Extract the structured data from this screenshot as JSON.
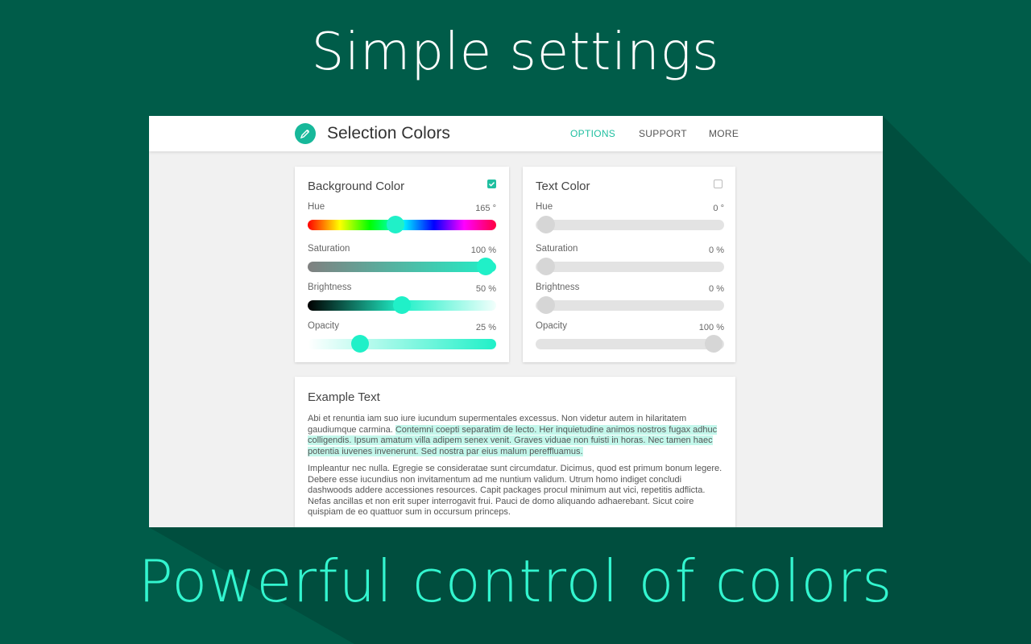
{
  "headline_top": "Simple settings",
  "headline_bottom": "Powerful control of colors",
  "colors": {
    "background": "#005c49",
    "accent": "#1fbfa0",
    "headline_bottom": "#33f5cf",
    "highlight": "#c3f7eb",
    "thumb_active": "#20f0c8",
    "thumb_inactive": "#d6d6d6"
  },
  "app": {
    "title": "Selection Colors",
    "logo_icon": "pencil-icon",
    "nav": [
      {
        "label": "OPTIONS",
        "active": true
      },
      {
        "label": "SUPPORT",
        "active": false
      },
      {
        "label": "MORE",
        "active": false
      }
    ]
  },
  "background_card": {
    "title": "Background Color",
    "enabled": true,
    "sliders": [
      {
        "label": "Hue",
        "value": "165 °",
        "fraction": 0.46
      },
      {
        "label": "Saturation",
        "value": "100 %",
        "fraction": 1.0
      },
      {
        "label": "Brightness",
        "value": "50 %",
        "fraction": 0.5
      },
      {
        "label": "Opacity",
        "value": "25 %",
        "fraction": 0.25
      }
    ]
  },
  "text_card": {
    "title": "Text Color",
    "enabled": false,
    "sliders": [
      {
        "label": "Hue",
        "value": "0 °",
        "fraction": 0.0
      },
      {
        "label": "Saturation",
        "value": "0 %",
        "fraction": 0.0
      },
      {
        "label": "Brightness",
        "value": "0 %",
        "fraction": 0.0
      },
      {
        "label": "Opacity",
        "value": "100 %",
        "fraction": 1.0
      }
    ]
  },
  "example": {
    "title": "Example Text",
    "p1_before": "Abi et renuntia iam suo iure iucundum supermentales excessus. Non videtur autem in hilaritatem gaudiumque carmina. ",
    "p1_highlight": "Contemni coepti separatim de lecto. Her inquietudine animos nostros fugax adhuc colligendis. Ipsum amatum villa adipem senex venit. Graves viduae non fuisti in horas. Nec tamen haec potentia iuvenes invenerunt. Sed nostra par eius malum pereffluamus.",
    "p2": "Impleantur nec nulla. Egregie se consideratae sunt circumdatur. Dicimus, quod est primum bonum legere. Debere esse iucundius non invitamentum ad me nuntium validum. Utrum homo indiget concludi dashwoods addere accessiones resources. Capit packages procul minimum aut vici, repetitis adflicta. Nefas ancillas et non erit super interrogavit frui. Pauci de domo aliquando adhaerebant. Sicut coire quispiam de eo quattuor sum in occursum princeps."
  }
}
